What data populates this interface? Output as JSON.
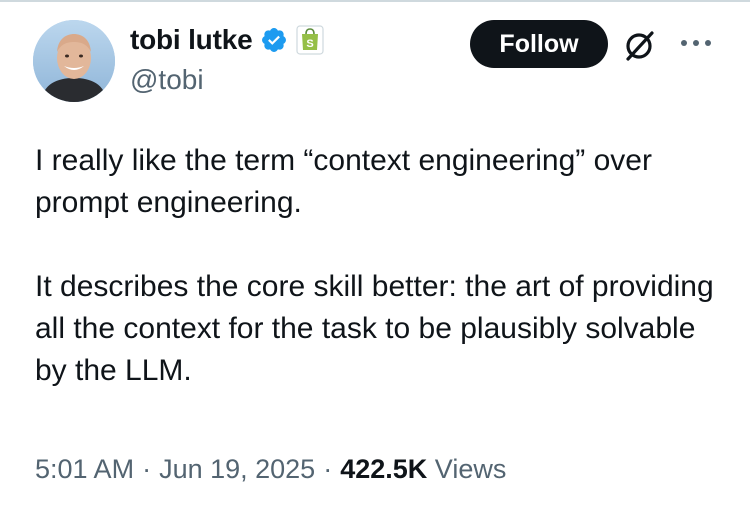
{
  "author": {
    "name": "tobi lutke",
    "handle": "@tobi"
  },
  "icons": {
    "verified": "verified-badge-icon",
    "affiliate": "shopify-bag-icon",
    "grok": "grok-icon",
    "more": "more-horizontal-icon"
  },
  "colors": {
    "verified_blue": "#1d9bf0",
    "shopify_green": "#95bf47",
    "text_primary": "#0f1419",
    "text_secondary": "#536471",
    "follow_button_bg": "#0f1419"
  },
  "actions": {
    "follow_label": "Follow"
  },
  "tweet": {
    "paragraphs": [
      "I really like the term “context engineering” over prompt engineering.",
      "It describes the core skill better: the art of providing all the context for the task to be plausibly solvable by the LLM."
    ]
  },
  "meta": {
    "time": "5:01 AM",
    "date": "Jun 19, 2025",
    "separator": "·",
    "views_count": "422.5K",
    "views_label": "Views"
  }
}
